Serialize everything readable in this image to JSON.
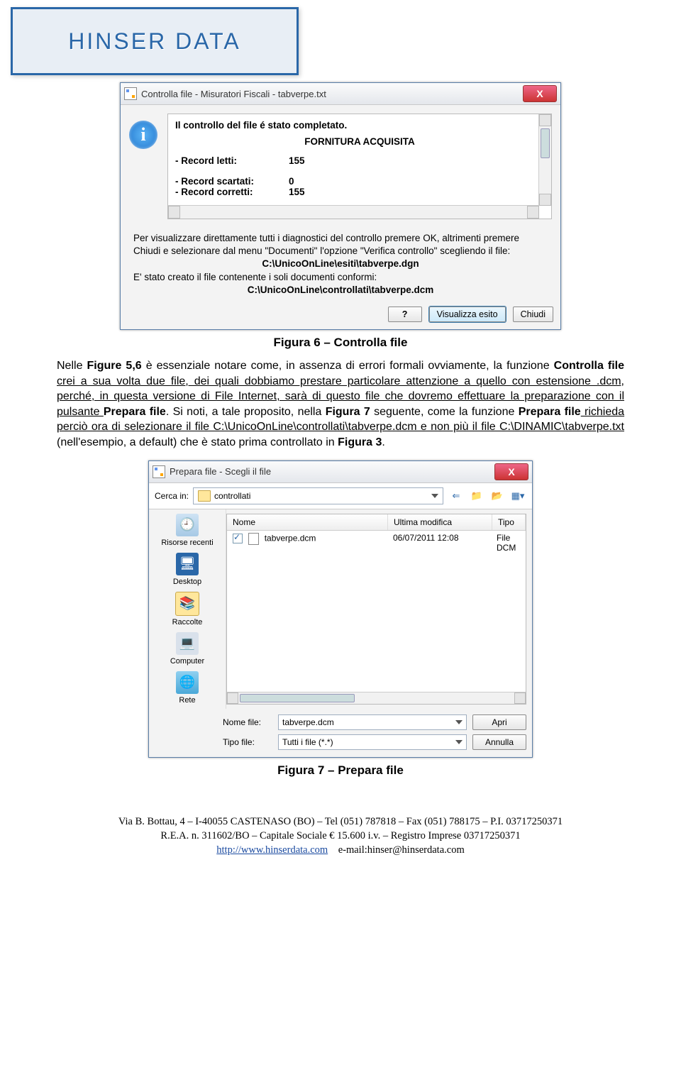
{
  "logo_text": "HINSER DATA",
  "dialog1": {
    "title": "Controlla file - Misuratori Fiscali - tabverpe.txt",
    "close_x": "X",
    "info_glyph": "i",
    "line1": "Il controllo del file é stato completato.",
    "line2": "FORNITURA ACQUISITA",
    "records": {
      "letti_label": "- Record letti:",
      "letti_val": "155",
      "scartati_label": "- Record scartati:",
      "scartati_val": "0",
      "corretti_label": "- Record corretti:",
      "corretti_val": "155"
    },
    "body_text1": "Per visualizzare direttamente tutti i diagnostici del controllo premere OK, altrimenti premere Chiudi e selezionare dal menu \"Documenti\" l'opzione \"Verifica controllo\" scegliendo il file:",
    "body_path1": "C:\\UnicoOnLine\\esiti\\tabverpe.dgn",
    "body_text2": "E' stato creato il file contenente i soli documenti conformi:",
    "body_path2": "C:\\UnicoOnLine\\controllati\\tabverpe.dcm",
    "btn_help": "?",
    "btn_view": "Visualizza esito",
    "btn_close": "Chiudi"
  },
  "caption1": "Figura 6 – Controlla file",
  "paragraph": {
    "p1a": "Nelle ",
    "p1b": "Figure 5,6",
    "p1c": " è essenziale notare come, in assenza di errori formali ovviamente, la funzione ",
    "p1d": "Controlla file",
    "p1e": " crei a sua volta due file, dei quali dobbiamo prestare particolare attenzione a quello con estensione .dcm, perché, in questa versione di File Internet, sarà di questo file che dovremo effettuare la preparazione con il pulsante ",
    "p1f": "Prepara file",
    "p1g": ". Si noti, a tale proposito, nella ",
    "p1h": "Figura 7",
    "p1i": " seguente, come la funzione ",
    "p1j": "Prepara file",
    "p1k": " richieda perciò ora di selezionare il file C:\\UnicoOnLine\\controllati\\tabverpe.dcm e non più il file C:\\DINAMIC\\tabverpe.txt",
    "p1l": " (nell'esempio, a default) che è stato prima controllato in ",
    "p1m": "Figura 3",
    "p1n": "."
  },
  "dialog2": {
    "title": "Prepara file - Scegli il file",
    "lookin_label": "Cerca in:",
    "lookin_value": "controllati",
    "places": {
      "recent": "Risorse recenti",
      "desktop": "Desktop",
      "libraries": "Raccolte",
      "computer": "Computer",
      "network": "Rete"
    },
    "cols": {
      "name": "Nome",
      "date": "Ultima modifica",
      "type": "Tipo"
    },
    "row": {
      "name": "tabverpe.dcm",
      "date": "06/07/2011 12:08",
      "type": "File DCM"
    },
    "filename_label": "Nome file:",
    "filename_value": "tabverpe.dcm",
    "filetype_label": "Tipo file:",
    "filetype_value": "Tutti i file (*.*)",
    "btn_open": "Apri",
    "btn_cancel": "Annulla"
  },
  "caption2": "Figura 7 – Prepara file",
  "footer": {
    "line1": "Via B. Bottau, 4 – I-40055 CASTENASO (BO) – Tel (051) 787818 – Fax (051) 788175 – P.I. 03717250371",
    "line2": "R.E.A. n. 311602/BO – Capitale Sociale € 15.600 i.v. – Registro Imprese 03717250371",
    "link": "http://www.hinserdata.com",
    "email": "e-mail:hinser@hinserdata.com"
  }
}
